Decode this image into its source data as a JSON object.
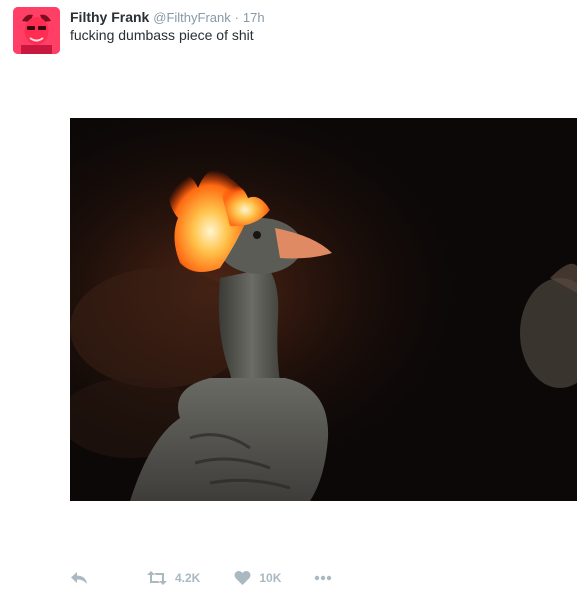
{
  "tweet": {
    "author": {
      "name": "Filthy Frank",
      "handle": "@FilthyFrank",
      "avatar_icon": "profile-avatar"
    },
    "separator": "·",
    "time": "17h",
    "text": "fucking dumbass piece of shit",
    "media": {
      "description_icon": "photo"
    },
    "actions": {
      "reply_icon": "reply-icon",
      "retweet_icon": "retweet-icon",
      "retweet_count": "4.2K",
      "like_icon": "heart-icon",
      "like_count": "10K",
      "more_icon": "more-icon"
    }
  },
  "colors": {
    "name": "#292f33",
    "meta": "#8899a6",
    "action": "#aab8c2",
    "media_bg": "#0b0807"
  }
}
